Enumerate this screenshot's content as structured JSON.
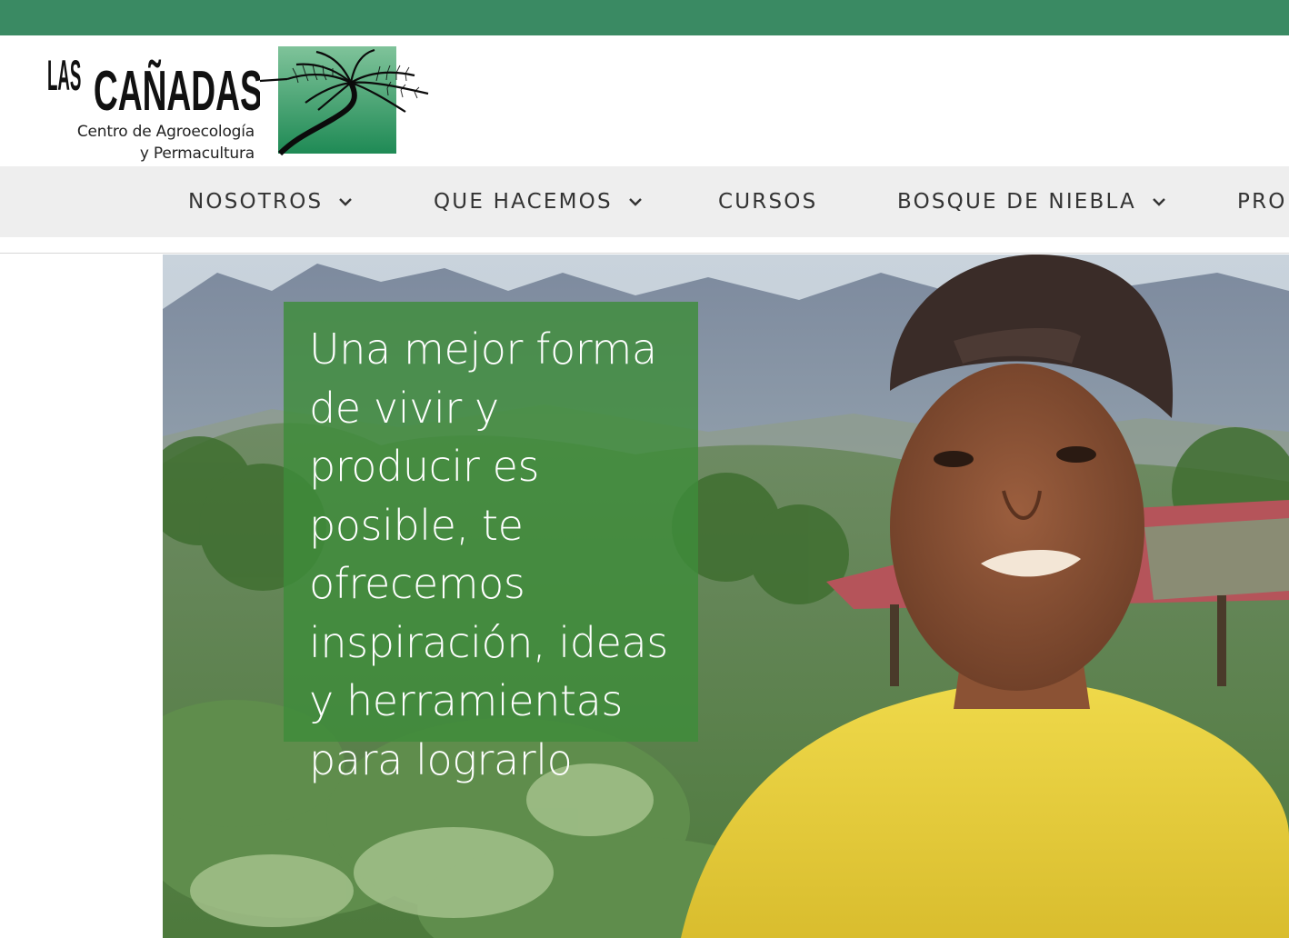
{
  "brand": {
    "name": "LAS CAÑADAS",
    "subtitle_line1": "Centro de Agroecología",
    "subtitle_line2": "y Permacultura"
  },
  "nav": {
    "items": [
      {
        "label": "NOSOTROS",
        "has_dropdown": true
      },
      {
        "label": "QUE HACEMOS",
        "has_dropdown": true
      },
      {
        "label": "CURSOS",
        "has_dropdown": false
      },
      {
        "label": "BOSQUE DE NIEBLA",
        "has_dropdown": true
      },
      {
        "label": "PRO",
        "has_dropdown": false
      }
    ]
  },
  "hero": {
    "headline": "Una mejor forma de vivir y producir es posible, te ofrecemos inspiración, ideas y herramientas para lograrlo"
  },
  "colors": {
    "topbar": "#3a8a63",
    "nav_background": "#eeeeee",
    "hero_overlay": "#3e8c3a"
  }
}
